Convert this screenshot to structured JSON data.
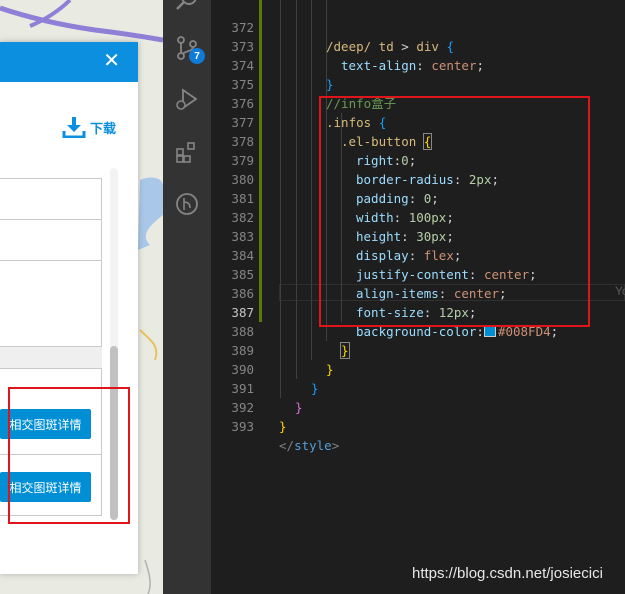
{
  "preview": {
    "close_glyph": "✕",
    "download_label": "下载",
    "detail_button_label": "相交图斑详情",
    "detail_buttons": [
      "相交图斑详情",
      "相交图斑详情"
    ]
  },
  "sidebar": {
    "scm_badge": "7",
    "icons": [
      "search-icon",
      "source-control-icon",
      "debug-icon",
      "extensions-icon",
      "remote-icon"
    ]
  },
  "editor": {
    "ghost_text": "Yo",
    "lines": [
      {
        "n": "372",
        "indent": 3
      },
      {
        "n": "373",
        "indent": 4
      },
      {
        "n": "374",
        "indent": 3
      },
      {
        "n": "375",
        "indent": 3
      },
      {
        "n": "376",
        "indent": 3
      },
      {
        "n": "377",
        "indent": 4
      },
      {
        "n": "378",
        "indent": 5
      },
      {
        "n": "379",
        "indent": 5
      },
      {
        "n": "380",
        "indent": 5
      },
      {
        "n": "381",
        "indent": 5
      },
      {
        "n": "382",
        "indent": 5
      },
      {
        "n": "383",
        "indent": 5
      },
      {
        "n": "384",
        "indent": 5
      },
      {
        "n": "385",
        "indent": 5
      },
      {
        "n": "386",
        "indent": 5
      },
      {
        "n": "387",
        "indent": 5
      },
      {
        "n": "388",
        "indent": 4
      },
      {
        "n": "389",
        "indent": 3
      },
      {
        "n": "390",
        "indent": 2
      },
      {
        "n": "391",
        "indent": 1
      },
      {
        "n": "392",
        "indent": 0
      },
      {
        "n": "393",
        "indent": 0
      }
    ],
    "tokens": {
      "l372": [
        "/deep/",
        " td ",
        "> ",
        "div",
        " ",
        "{"
      ],
      "l373": [
        "text-align",
        ": ",
        "center",
        ";"
      ],
      "l374": [
        "}"
      ],
      "l375": [
        "//info盒子"
      ],
      "l376": [
        ".infos",
        " ",
        "{"
      ],
      "l377": [
        ".el-button",
        " ",
        "{"
      ],
      "l378": [
        "right",
        ":",
        "0",
        ";"
      ],
      "l379": [
        "border-radius",
        ": ",
        "2px",
        ";"
      ],
      "l380": [
        "padding",
        ": ",
        "0",
        ";"
      ],
      "l381": [
        "width",
        ": ",
        "100px",
        ";"
      ],
      "l382": [
        "height",
        ": ",
        "30px",
        ";"
      ],
      "l383": [
        "display",
        ": ",
        "flex",
        ";"
      ],
      "l384": [
        "justify-content",
        ": ",
        "center",
        ";"
      ],
      "l385": [
        "align-items",
        ": ",
        "center",
        ";"
      ],
      "l386": [
        "font-size",
        ": ",
        "12px",
        ";"
      ],
      "l387": [
        "background-color",
        ":",
        "#008FD4",
        ";"
      ],
      "l388": [
        "}"
      ],
      "l389": [
        "}"
      ],
      "l390": [
        "}"
      ],
      "l391": [
        "}"
      ],
      "l392": [
        "}"
      ],
      "l393": [
        "</",
        "style",
        ">"
      ]
    },
    "swatch_color": "#008FD4"
  },
  "watermark": "https://blog.csdn.net/josiecici",
  "colors": {
    "accent": "#0d8fe0",
    "button": "#008fd4",
    "highlight_box": "#e0151b",
    "editor_bg": "#1e1e1e",
    "activity_bg": "#333333"
  }
}
